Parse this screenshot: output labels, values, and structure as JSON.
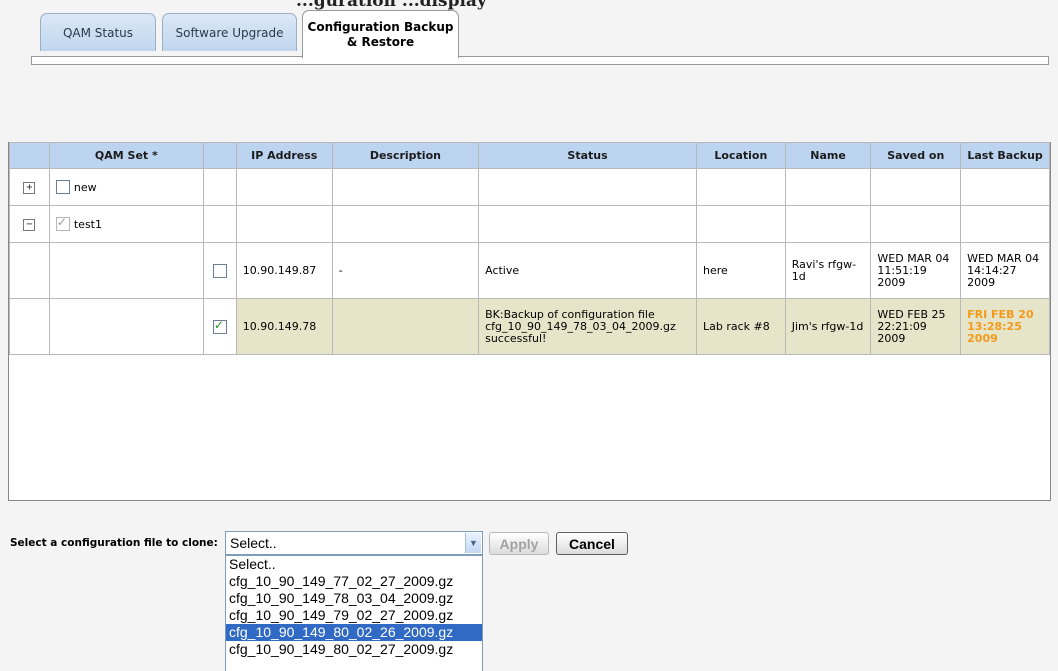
{
  "header": {
    "clipped_title": "...guration ...display"
  },
  "tabs": [
    {
      "label": "QAM Status"
    },
    {
      "label": "Software Upgrade"
    },
    {
      "label": "Configuration Backup\n& Restore"
    }
  ],
  "table": {
    "columns": [
      "",
      "QAM Set *",
      "",
      "IP Address",
      "Description",
      "Status",
      "Location",
      "Name",
      "Saved on",
      "Last Backup"
    ],
    "sets": [
      {
        "expander": "+",
        "name": "new",
        "checked": false
      },
      {
        "expander": "−",
        "name": "test1",
        "checked": true
      }
    ],
    "rows": [
      {
        "checked": false,
        "ip": "10.90.149.87",
        "description": "-",
        "status": "Active",
        "location": "here",
        "name": "Ravi's rfgw-1d",
        "saved_on": "WED MAR 04 11:51:19 2009",
        "last_backup": "WED MAR 04 14:14:27 2009"
      },
      {
        "checked": true,
        "ip": "10.90.149.78",
        "description": "",
        "status": "BK:Backup of configuration file cfg_10_90_149_78_03_04_2009.gz successful!",
        "location": "Lab rack #8",
        "name": "Jim's rfgw-1d",
        "saved_on": "WED FEB 25 22:21:09 2009",
        "last_backup": "FRI FEB 20 13:28:25 2009"
      }
    ]
  },
  "clone": {
    "label": "Select a configuration file to clone:",
    "selected": "Select..",
    "apply_label": "Apply",
    "cancel_label": "Cancel",
    "options": [
      "Select..",
      "cfg_10_90_149_77_02_27_2009.gz",
      "cfg_10_90_149_78_03_04_2009.gz",
      "cfg_10_90_149_79_02_27_2009.gz",
      "cfg_10_90_149_80_02_26_2009.gz",
      "cfg_10_90_149_80_02_27_2009.gz"
    ],
    "highlighted_option": 4
  },
  "colors": {
    "header_bg": "#bcd4f0",
    "selected_row_bg": "#e6e5c9",
    "highlight": "#316ac5",
    "alert_text": "#f39a1a"
  }
}
